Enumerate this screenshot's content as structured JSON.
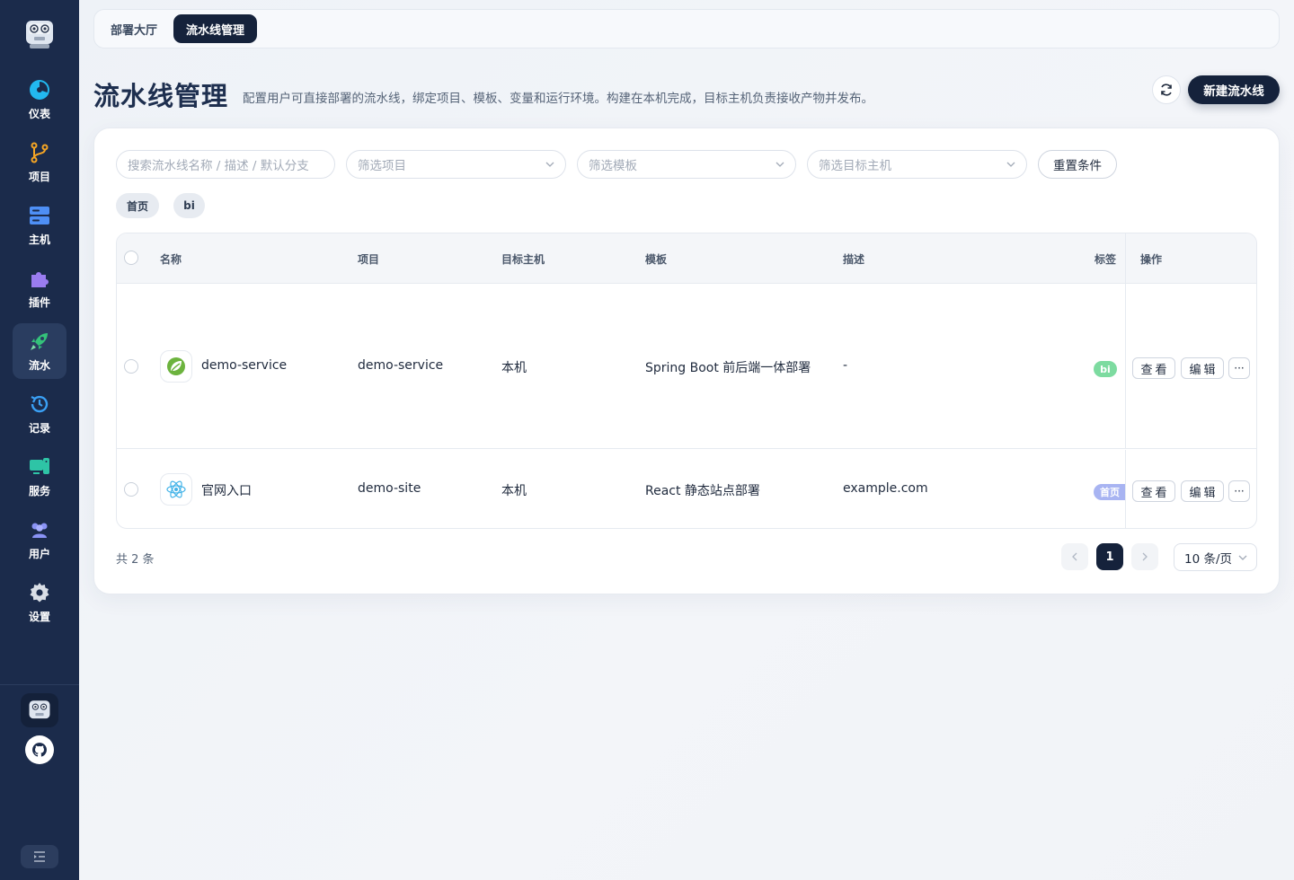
{
  "sidebar": {
    "items": [
      {
        "label": "仪表",
        "icon": "pie-chart-icon",
        "color": "#22b8f0"
      },
      {
        "label": "项目",
        "icon": "git-branch-icon",
        "color": "#f5a524"
      },
      {
        "label": "主机",
        "icon": "server-icon",
        "color": "#4e8ff5"
      },
      {
        "label": "插件",
        "icon": "puzzle-icon",
        "color": "#9a7cf0"
      },
      {
        "label": "流水",
        "icon": "rocket-icon",
        "color": "#34c27a",
        "active": true
      },
      {
        "label": "记录",
        "icon": "history-icon",
        "color": "#3aa0f5"
      },
      {
        "label": "服务",
        "icon": "services-icon",
        "color": "#2ec4a6"
      },
      {
        "label": "用户",
        "icon": "users-icon",
        "color": "#8a93f5"
      },
      {
        "label": "设置",
        "icon": "gear-icon",
        "color": "#d9dee6"
      }
    ]
  },
  "tabs": [
    {
      "label": "部署大厅",
      "active": false
    },
    {
      "label": "流水线管理",
      "active": true
    }
  ],
  "header": {
    "title": "流水线管理",
    "description": "配置用户可直接部署的流水线，绑定项目、模板、变量和运行环境。构建在本机完成，目标主机负责接收产物并发布。",
    "new_button": "新建流水线"
  },
  "filters": {
    "search_placeholder": "搜索流水线名称 / 描述 / 默认分支",
    "project_placeholder": "筛选项目",
    "template_placeholder": "筛选模板",
    "host_placeholder": "筛选目标主机",
    "reset_label": "重置条件"
  },
  "tag_filters": [
    "首页",
    "bi"
  ],
  "table": {
    "columns": [
      "名称",
      "项目",
      "目标主机",
      "模板",
      "描述",
      "标签",
      "操作"
    ],
    "rows": [
      {
        "name": "demo-service",
        "icon": "spring-leaf-icon",
        "project": "demo-service",
        "host": "本机",
        "template": "Spring Boot 前后端一体部署",
        "description": "-",
        "tag": "bi",
        "tag_color": "#7ddba0",
        "view": "查看",
        "edit": "编辑",
        "more": "···"
      },
      {
        "name": "官网入口",
        "icon": "react-icon",
        "project": "demo-site",
        "host": "本机",
        "template": "React 静态站点部署",
        "description": "example.com",
        "tag": "首页",
        "tag_color": "#a8b4f2",
        "view": "查看",
        "edit": "编辑",
        "more": "···"
      }
    ]
  },
  "footer": {
    "total": "共 2 条",
    "current_page": "1",
    "page_size": "10 条/页"
  },
  "colors": {
    "sidebar_bg": "#1b2b4b",
    "primary_dark": "#15223b"
  }
}
